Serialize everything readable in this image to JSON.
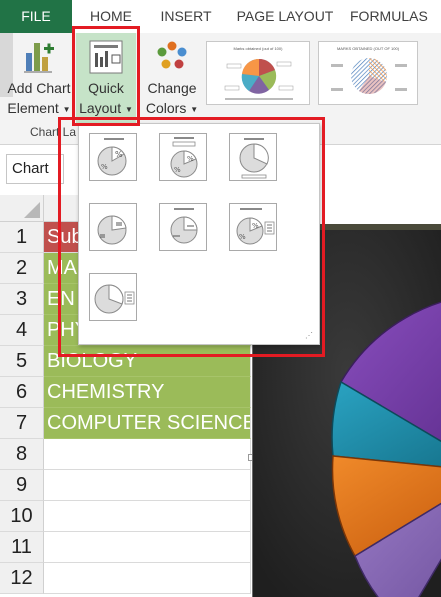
{
  "tabs": [
    "FILE",
    "HOME",
    "INSERT",
    "PAGE LAYOUT",
    "FORMULAS"
  ],
  "ribbon": {
    "add_chart_element": {
      "line1": "Add Chart",
      "line2": "Element"
    },
    "quick_layout": {
      "line1": "Quick",
      "line2": "Layout"
    },
    "change_colors": {
      "line1": "Change",
      "line2": "Colors"
    },
    "group_label": "Chart La"
  },
  "style_gallery": {
    "style1_title": "Marks obtained (out of 100)",
    "style2_title": "MARKS OBTAINED (OUT OF 100)"
  },
  "name_box": "Chart",
  "rows": [
    {
      "num": "1",
      "text": "Sub"
    },
    {
      "num": "2",
      "text": "MA"
    },
    {
      "num": "3",
      "text": "EN"
    },
    {
      "num": "4",
      "text": "PHY"
    },
    {
      "num": "5",
      "text": "BIOLOGY"
    },
    {
      "num": "6",
      "text": "CHEMISTRY"
    },
    {
      "num": "7",
      "text": "COMPUTER SCIENCE"
    },
    {
      "num": "8",
      "text": ""
    },
    {
      "num": "9",
      "text": ""
    },
    {
      "num": "10",
      "text": ""
    },
    {
      "num": "11",
      "text": ""
    },
    {
      "num": "12",
      "text": ""
    }
  ],
  "colors": {
    "file_tab": "#217346",
    "header_cell": "#c0504d",
    "data_cells": "#9bbb59",
    "highlight": "#e31b23",
    "pie_purple": "#7030a0",
    "pie_teal": "#1a8aa6",
    "pie_orange": "#e06c12"
  },
  "icons": [
    "add-chart-element-icon",
    "quick-layout-icon",
    "change-colors-icon"
  ]
}
